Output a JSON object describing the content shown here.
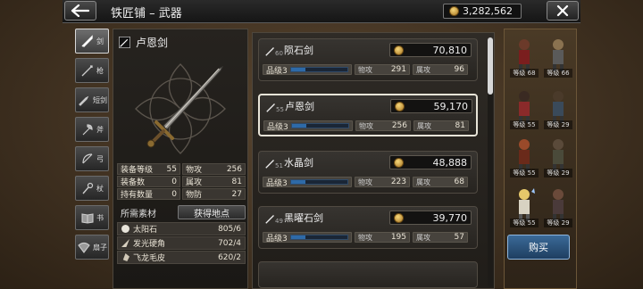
{
  "header": {
    "title": "铁匠铺 – 武器",
    "gold": "3,282,562"
  },
  "tabs": [
    {
      "label": "剑",
      "icon": "sword-icon",
      "active": true
    },
    {
      "label": "枪",
      "icon": "spear-icon",
      "active": false
    },
    {
      "label": "短剑",
      "icon": "dagger-icon",
      "active": false
    },
    {
      "label": "斧",
      "icon": "axe-icon",
      "active": false
    },
    {
      "label": "弓",
      "icon": "bow-icon",
      "active": false
    },
    {
      "label": "杖",
      "icon": "staff-icon",
      "active": false
    },
    {
      "label": "书",
      "icon": "book-icon",
      "active": false
    },
    {
      "label": "扇子",
      "icon": "fan-icon",
      "active": false
    }
  ],
  "detail": {
    "name": "卢恩剑",
    "stats": [
      [
        {
          "label": "装备等级",
          "value": "55"
        },
        {
          "label": "物攻",
          "value": "256"
        }
      ],
      [
        {
          "label": "装备数",
          "value": "0"
        },
        {
          "label": "属攻",
          "value": "81"
        }
      ],
      [
        {
          "label": "持有数量",
          "value": "0"
        },
        {
          "label": "物防",
          "value": "27"
        }
      ]
    ],
    "materials_label": "所需素材",
    "obtain_label": "获得地点",
    "materials": [
      {
        "name": "太阳石",
        "count": "805/6"
      },
      {
        "name": "发光硬角",
        "count": "702/4"
      },
      {
        "name": "飞龙毛皮",
        "count": "620/2"
      }
    ]
  },
  "weapons": [
    {
      "level": "60",
      "name": "陨石剑",
      "price": "70,810",
      "rank_label": "品级3",
      "rank_fill": 0.25,
      "patk_label": "物攻",
      "patk": "291",
      "eatk_label": "属攻",
      "eatk": "96",
      "selected": false
    },
    {
      "level": "55",
      "name": "卢恩剑",
      "price": "59,170",
      "rank_label": "品级3",
      "rank_fill": 0.25,
      "patk_label": "物攻",
      "patk": "256",
      "eatk_label": "属攻",
      "eatk": "81",
      "selected": true
    },
    {
      "level": "51",
      "name": "水晶剑",
      "price": "48,888",
      "rank_label": "品级3",
      "rank_fill": 0.25,
      "patk_label": "物攻",
      "patk": "223",
      "eatk_label": "属攻",
      "eatk": "68",
      "selected": false
    },
    {
      "level": "49",
      "name": "黑曜石剑",
      "price": "39,770",
      "rank_label": "品级3",
      "rank_fill": 0.25,
      "patk_label": "物攻",
      "patk": "195",
      "eatk_label": "属攻",
      "eatk": "57",
      "selected": false
    }
  ],
  "party": [
    {
      "level": "等级 68"
    },
    {
      "level": "等级 66"
    },
    {
      "level": "等级 55"
    },
    {
      "level": "等级 29"
    },
    {
      "level": "等级 55"
    },
    {
      "level": "等级 29"
    },
    {
      "level": "等级 55"
    },
    {
      "level": "等级 29"
    }
  ],
  "buy_label": "购买",
  "colors": {
    "accent_blue": "#2e6aa8",
    "gold": "#d6a63a",
    "panel": "#26231f"
  }
}
